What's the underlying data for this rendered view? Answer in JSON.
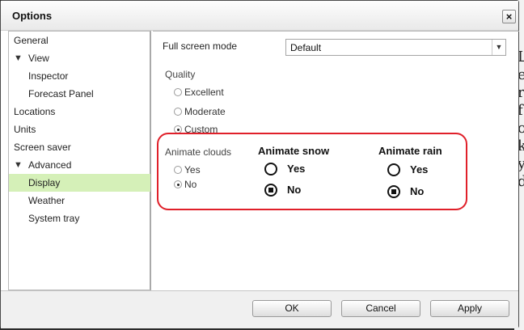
{
  "dialog": {
    "title": "Options",
    "close_glyph": "×"
  },
  "background_text": [
    "L",
    "e",
    "re",
    "f",
    "oi",
    "k",
    "",
    "y",
    "d"
  ],
  "sidebar": {
    "items": [
      {
        "label": "General",
        "indent": 0,
        "arrow": ""
      },
      {
        "label": "View",
        "indent": 1,
        "arrow": "▼"
      },
      {
        "label": "Inspector",
        "indent": 2,
        "arrow": ""
      },
      {
        "label": "Forecast Panel",
        "indent": 2,
        "arrow": ""
      },
      {
        "label": "Locations",
        "indent": 0,
        "arrow": ""
      },
      {
        "label": "Units",
        "indent": 0,
        "arrow": ""
      },
      {
        "label": "Screen saver",
        "indent": 0,
        "arrow": ""
      },
      {
        "label": "Advanced",
        "indent": 1,
        "arrow": "▼"
      },
      {
        "label": "Display",
        "indent": 2,
        "arrow": "",
        "selected": true
      },
      {
        "label": "Weather",
        "indent": 2,
        "arrow": ""
      },
      {
        "label": "System tray",
        "indent": 2,
        "arrow": ""
      }
    ]
  },
  "display": {
    "full_screen_label": "Full screen mode",
    "full_screen_value": "Default",
    "quality_label": "Quality",
    "quality_options": [
      {
        "label": "Excellent",
        "checked": false
      },
      {
        "label": "Moderate",
        "checked": false
      },
      {
        "label": "Custom",
        "checked": true
      }
    ],
    "animate_clouds": {
      "label": "Animate clouds",
      "options": [
        {
          "label": "Yes",
          "checked": false
        },
        {
          "label": "No",
          "checked": true
        }
      ]
    },
    "animate_snow": {
      "label": "Animate snow",
      "options": [
        {
          "label": "Yes",
          "checked": false
        },
        {
          "label": "No",
          "checked": true
        }
      ]
    },
    "animate_rain": {
      "label": "Animate rain",
      "options": [
        {
          "label": "Yes",
          "checked": false
        },
        {
          "label": "No",
          "checked": true
        }
      ]
    },
    "highlight_color": "#e0202a"
  },
  "buttons": {
    "ok": "OK",
    "cancel": "Cancel",
    "apply": "Apply"
  },
  "colors": {
    "selected_item": "#d5f0b8"
  }
}
